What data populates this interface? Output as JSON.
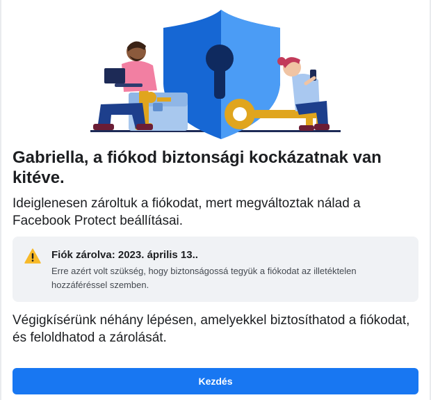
{
  "header": {
    "title": "Gabriella, a fiókod biztonsági kockázatnak van kitéve.",
    "description": "Ideiglenesen zároltuk a fiókodat, mert megváltoztak nálad a Facebook Protect beállításai."
  },
  "notice": {
    "icon": "warning-icon",
    "title": "Fiók zárolva: 2023. április 13..",
    "text": "Erre azért volt szükség, hogy biztonságossá tegyük a fiókodat az illetéktelen hozzáféréssel szemben."
  },
  "guide": {
    "text": "Végigkísérünk néhány lépésen, amelyekkel biztosíthatod a fiókodat, és feloldhatod a zárolását."
  },
  "actions": {
    "start_label": "Kezdés"
  },
  "colors": {
    "primary": "#1877f2",
    "notice_bg": "#f0f2f5",
    "warning": "#f7b928",
    "shield_light": "#4b9cf5",
    "shield_dark": "#1667d4",
    "key_gold": "#e0a51e"
  }
}
